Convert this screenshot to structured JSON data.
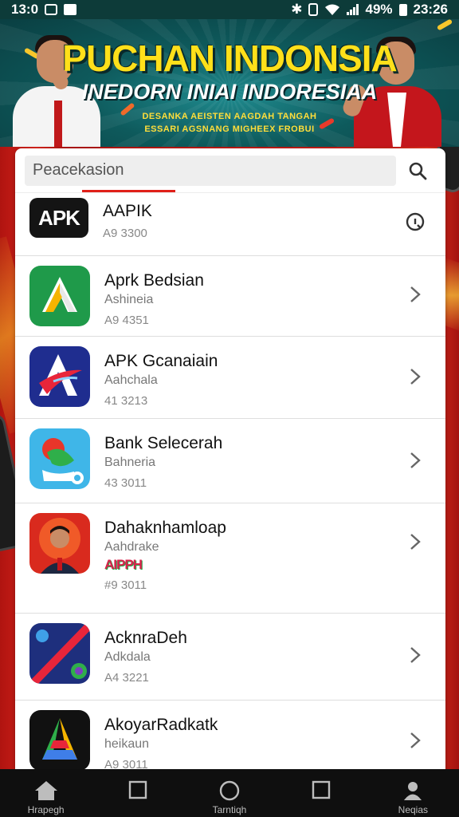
{
  "status_bar": {
    "time": "13:0",
    "battery_percent": "49%",
    "clock": "23:26"
  },
  "banner": {
    "title": "PUCHAN INDONSIA",
    "subtitle": "INEDORN INIAI INDORESIAA",
    "line1": "DESANKA AEISTEN AAGDAH TANGAH",
    "line2": "ESSARI AGSNANG MIGHEEX FROBUI"
  },
  "search": {
    "placeholder": "Peacekasion"
  },
  "apps": [
    {
      "name": "AAPIK",
      "subtitle": "",
      "meta": "A9 3300",
      "icon_label": "APK",
      "action": "info-icon"
    },
    {
      "name": "Aprk Bedsian",
      "subtitle": "Ashineia",
      "meta": "A9 4351",
      "icon_label": "",
      "action": "chevron-right-icon"
    },
    {
      "name": "APK Gcanaiain",
      "subtitle": "Aahchala",
      "meta": "41 3213",
      "icon_label": "",
      "action": "chevron-right-icon"
    },
    {
      "name": "Bank Selecerah",
      "subtitle": "Bahneria",
      "meta": "43 3011",
      "icon_label": "",
      "action": "chevron-right-icon"
    },
    {
      "name": "Dahaknhamloap",
      "subtitle": "Aahdrake",
      "badge": "AIPPH",
      "meta": "#9 3011",
      "icon_label": "",
      "action": "chevron-right-icon"
    },
    {
      "name": "AcknraDeh",
      "subtitle": "Adkdala",
      "meta": "A4 3221",
      "icon_label": "",
      "action": "chevron-right-icon"
    },
    {
      "name": "AkoyarRadkatk",
      "subtitle": "heikaun",
      "meta": "A9 3011",
      "icon_label": "",
      "action": "chevron-right-icon"
    }
  ],
  "bottom_nav": [
    {
      "label": "Hrapegh",
      "icon": "home-icon"
    },
    {
      "label": "",
      "icon": "square-icon"
    },
    {
      "label": "Tarntiqh",
      "icon": "circle-icon"
    },
    {
      "label": "",
      "icon": "square-icon"
    },
    {
      "label": "Neqias",
      "icon": "person-icon"
    }
  ],
  "colors": {
    "accent": "#e02019",
    "banner_title": "#ffe01a",
    "background": "#c81c17"
  }
}
